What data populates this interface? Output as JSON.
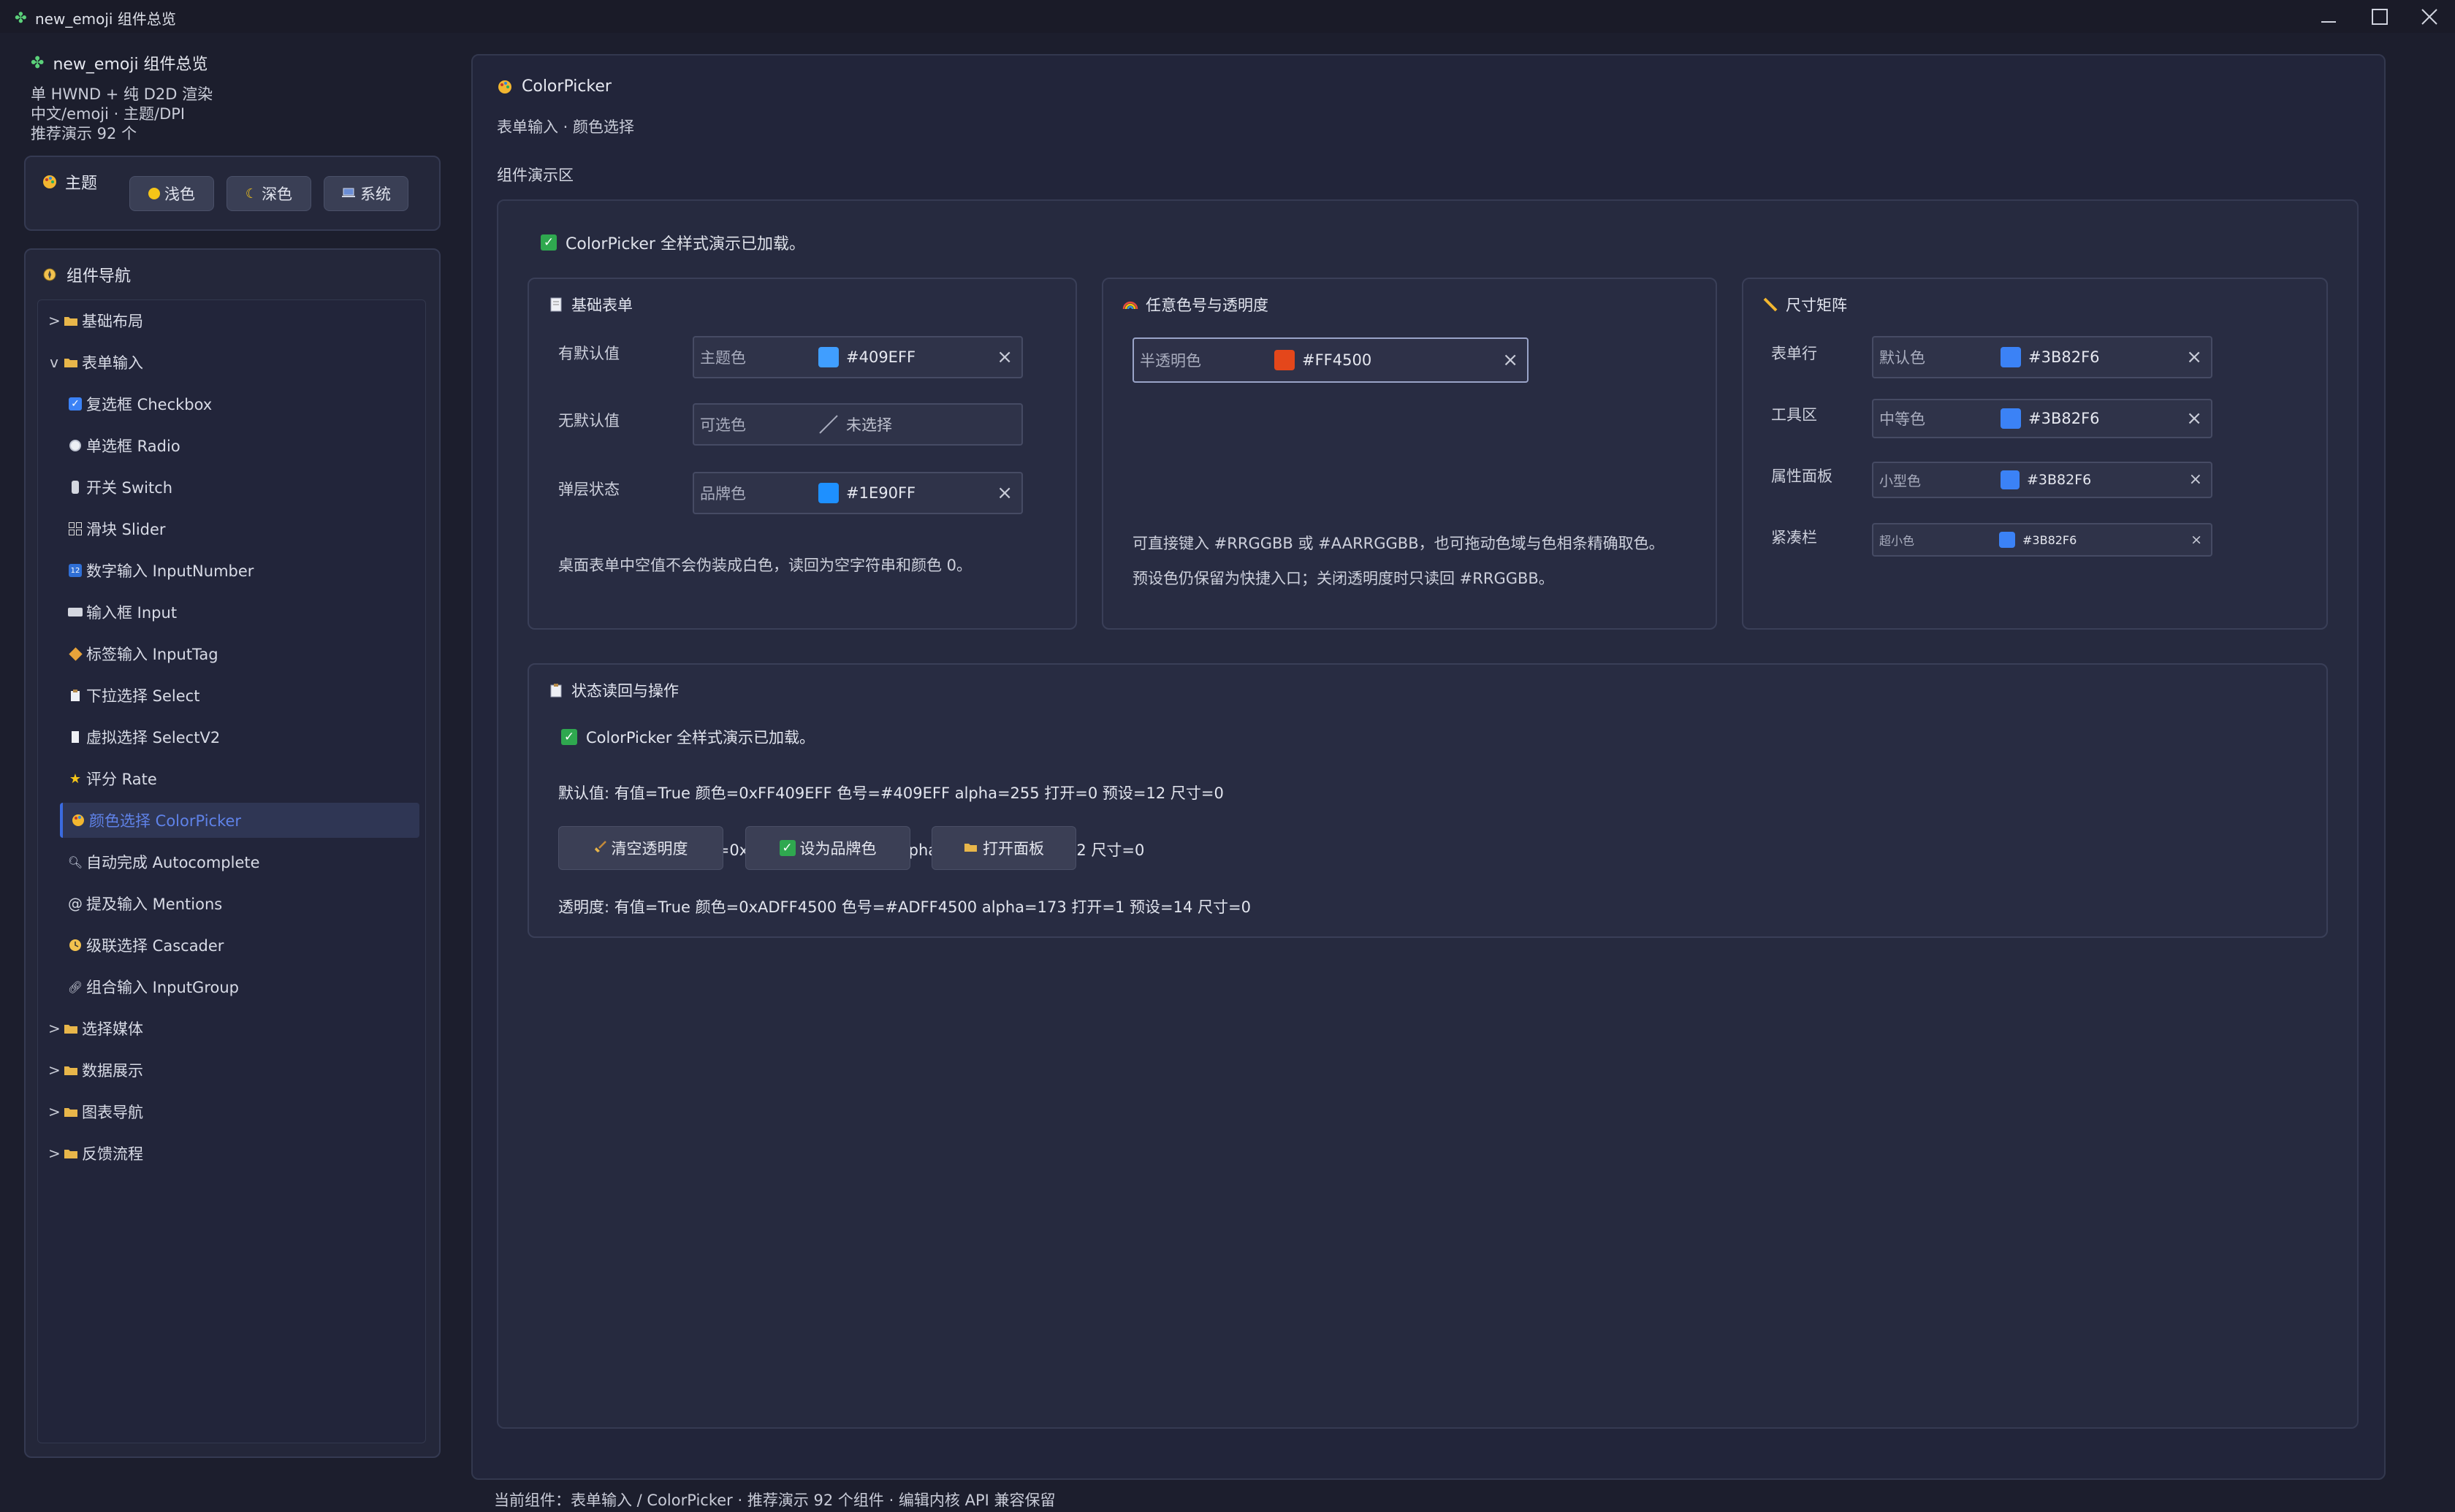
{
  "window": {
    "title": "new_emoji 组件总览",
    "app_icon": "leaf-icon",
    "controls": [
      "minimize-icon",
      "maximize-icon",
      "close-icon"
    ]
  },
  "sidebar": {
    "brand": "new_emoji 组件总览",
    "meta_lines": [
      "单 HWND + 纯 D2D 渲染",
      "中文/emoji · 主题/DPI",
      "推荐演示 92 个"
    ],
    "theme": {
      "label": "主题",
      "buttons": [
        {
          "label": "浅色",
          "icon": "sun-icon"
        },
        {
          "label": "深色",
          "icon": "moon-icon"
        },
        {
          "label": "系统",
          "icon": "laptop-icon"
        }
      ]
    },
    "nav": {
      "title": "组件导航",
      "items": [
        {
          "label": "基础布局",
          "chev": ">",
          "icon": "folder-icon",
          "sub": false
        },
        {
          "label": "表单输入",
          "chev": "v",
          "icon": "folder-icon",
          "sub": false
        },
        {
          "label": "复选框 Checkbox",
          "icon": "checkbox-icon",
          "sub": true
        },
        {
          "label": "单选框 Radio",
          "icon": "radio-icon",
          "sub": true
        },
        {
          "label": "开关 Switch",
          "icon": "switch-icon",
          "sub": true
        },
        {
          "label": "滑块 Slider",
          "icon": "slider-icon",
          "sub": true
        },
        {
          "label": "数字输入 InputNumber",
          "icon": "numbers-icon",
          "sub": true
        },
        {
          "label": "输入框 Input",
          "icon": "keyboard-icon",
          "sub": true
        },
        {
          "label": "标签输入 InputTag",
          "icon": "tag-icon",
          "sub": true
        },
        {
          "label": "下拉选择 Select",
          "icon": "clipboard-icon",
          "sub": true
        },
        {
          "label": "虚拟选择 SelectV2",
          "icon": "page-icon",
          "sub": true
        },
        {
          "label": "评分 Rate",
          "icon": "star-icon",
          "sub": true
        },
        {
          "label": "颜色选择 ColorPicker",
          "icon": "palette-icon",
          "sub": true,
          "active": true
        },
        {
          "label": "自动完成 Autocomplete",
          "icon": "magnifier-icon",
          "sub": true
        },
        {
          "label": "提及输入 Mentions",
          "icon": "at-icon",
          "sub": true
        },
        {
          "label": "级联选择 Cascader",
          "icon": "clock-icon",
          "sub": true
        },
        {
          "label": "组合输入 InputGroup",
          "icon": "link-icon",
          "sub": true
        },
        {
          "label": "选择媒体",
          "chev": ">",
          "icon": "folder-icon",
          "sub": false
        },
        {
          "label": "数据展示",
          "chev": ">",
          "icon": "folder-icon",
          "sub": false
        },
        {
          "label": "图表导航",
          "chev": ">",
          "icon": "folder-icon",
          "sub": false
        },
        {
          "label": "反馈流程",
          "chev": ">",
          "icon": "folder-icon",
          "sub": false
        }
      ]
    }
  },
  "main": {
    "title": "ColorPicker",
    "subtitle": "表单输入 · 颜色选择",
    "demo_area_title": "组件演示区",
    "loaded_text": "ColorPicker 全样式演示已加载。",
    "basic_card": {
      "title": "基础表单",
      "rows": [
        {
          "label": "有默认值",
          "placeholder": "主题色",
          "value": "#409EFF",
          "swatch": "#409EFF",
          "clearable": true
        },
        {
          "label": "无默认值",
          "placeholder": "可选色",
          "value": "未选择",
          "swatch": "none",
          "clearable": false
        },
        {
          "label": "弹层状态",
          "placeholder": "品牌色",
          "value": "#1E90FF",
          "swatch": "#1E90FF",
          "clearable": true
        }
      ],
      "note": "桌面表单中空值不会伪装成白色，读回为空字符串和颜色 0。"
    },
    "alpha_card": {
      "title": "任意色号与透明度",
      "picker": {
        "placeholder": "半透明色",
        "value": "#FF4500",
        "swatch": "#E4471B"
      },
      "notes": [
        "可直接键入 #RRGGBB 或 #AARRGGBB，也可拖动色域与色相条精确取色。",
        "预设色仍保留为快捷入口；关闭透明度时只读回 #RRGGBB。"
      ]
    },
    "size_card": {
      "title": "尺寸矩阵",
      "rows": [
        {
          "label": "表单行",
          "placeholder": "默认色",
          "value": "#3B82F6",
          "swatch": "#3B82F6"
        },
        {
          "label": "工具区",
          "placeholder": "中等色",
          "value": "#3B82F6",
          "swatch": "#3B82F6"
        },
        {
          "label": "属性面板",
          "placeholder": "小型色",
          "value": "#3B82F6",
          "swatch": "#3B82F6"
        },
        {
          "label": "紧凑栏",
          "placeholder": "超小色",
          "value": "#3B82F6",
          "swatch": "#3B82F6"
        }
      ]
    },
    "state_card": {
      "title": "状态读回与操作",
      "loaded_text": "ColorPicker 全样式演示已加载。",
      "lines": [
        "默认值: 有值=True 颜色=0xFF409EFF 色号=#409EFF alpha=255 打开=0 预设=12 尺寸=0",
        "空值: 有值=False 颜色=0x00000000 色号=空 alpha=0 打开=0 预设=12 尺寸=0",
        "透明度: 有值=True 颜色=0xADFF4500 色号=#ADFF4500 alpha=173 打开=1 预设=14 尺寸=0"
      ],
      "buttons": [
        {
          "label": "清空透明度",
          "icon": "broom-icon"
        },
        {
          "label": "设为品牌色",
          "icon": "check-icon"
        },
        {
          "label": "打开面板",
          "icon": "open-folder-icon"
        }
      ]
    },
    "status_bar": "当前组件：表单输入 / ColorPicker · 推荐演示 92 个组件 · 编辑内核 API 兼容保留"
  }
}
